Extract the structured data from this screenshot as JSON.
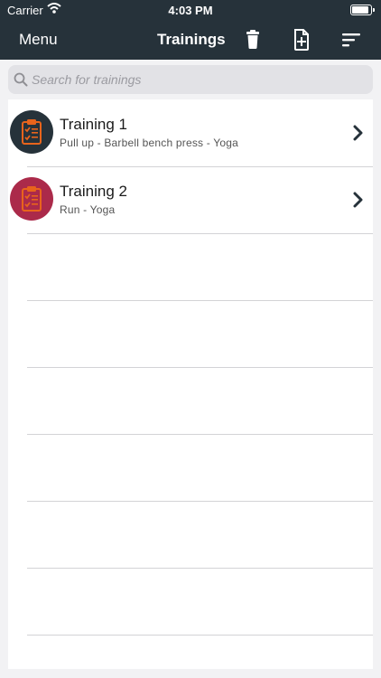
{
  "status": {
    "carrier": "Carrier",
    "time": "4:03 PM",
    "battery_level": 1.0
  },
  "navbar": {
    "menu_label": "Menu",
    "title": "Trainings",
    "icons": [
      "trash-icon",
      "new-document-icon",
      "sort-icon"
    ]
  },
  "search": {
    "placeholder": "Search for trainings",
    "value": ""
  },
  "colors": {
    "navbar_bg": "#26323a",
    "accent_orange": "#e8641c",
    "avatar_dark": "#26323a",
    "avatar_red": "#ab2a4a"
  },
  "trainings": [
    {
      "title": "Training 1",
      "subtitle": "Pull up - Barbell bench press - Yoga",
      "avatar_color": "#26323a"
    },
    {
      "title": "Training 2",
      "subtitle": "Run - Yoga",
      "avatar_color": "#ab2a4a"
    }
  ]
}
